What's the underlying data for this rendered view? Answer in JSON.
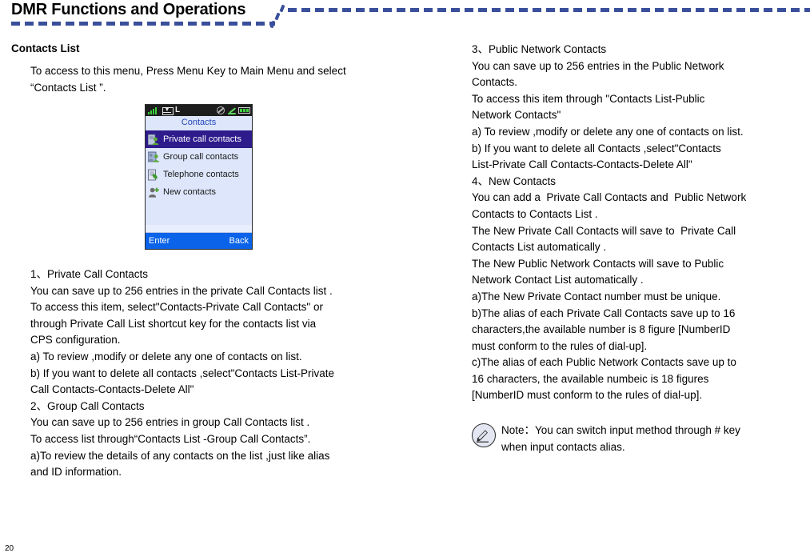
{
  "header": {
    "title": "DMR Functions and Operations",
    "rule_color": "#3a4f9b"
  },
  "left_column": {
    "heading": "Contacts List",
    "intro": "To access to this menu, Press Menu Key to Main Menu and select “Contacts List ”.",
    "phone_screenshot": {
      "status_bar": {
        "signal_icon": "signal-bars-icon",
        "message_icon": "envelope-icon",
        "mode_label": "L",
        "mute_icon": "no-entry-icon",
        "antenna_icon": "antenna-icon",
        "battery_icon": "battery-icon"
      },
      "title": "Contacts",
      "items": [
        {
          "label": "Private call contacts",
          "icon": "private-contact-icon",
          "selected": true
        },
        {
          "label": "Group call contacts",
          "icon": "group-contact-icon",
          "selected": false
        },
        {
          "label": "Telephone contacts",
          "icon": "telephone-contact-icon",
          "selected": false
        },
        {
          "label": "New contacts",
          "icon": "new-contact-icon",
          "selected": false
        }
      ],
      "softkey_left": "Enter",
      "softkey_right": "Back"
    },
    "body_lines": [
      "1、Private Call Contacts",
      "You can save up to 256 entries in the private Call Contacts list .",
      "To access this item, select\"Contacts-Private Call Contacts\" or",
      "through Private Call List shortcut key for the contacts list via",
      "CPS configuration.",
      "a) To review ,modify or delete any one of contacts on list.",
      "b) If you want to delete all contacts ,select\"Contacts List-Private",
      "Call Contacts-Contacts-Delete All\"",
      "2、Group Call Contacts",
      "You can save up to 256 entries in group Call Contacts list .",
      "To access list through“Contacts List -Group Call Contacts”.",
      "a)To review the details of any contacts on the list ,just like alias",
      "and ID information."
    ]
  },
  "right_column": {
    "body_lines": [
      "3、Public Network Contacts",
      "You can save up to 256 entries in the Public Network",
      "Contacts.",
      "To access this item through \"Contacts List-Public",
      "Network Contacts\"",
      "a) To review ,modify or delete any one of contacts on list.",
      "b) If you want to delete all Contacts ,select\"Contacts",
      "List-Private Call Contacts-Contacts-Delete All\"",
      "4、New Contacts",
      "You can add a  Private Call Contacts and  Public Network",
      "Contacts to Contacts List .",
      "The New Private Call Contacts will save to  Private Call",
      "Contacts List automatically .",
      "The New Public Network Contacts will save to Public",
      "Network Contact List automatically .",
      "a)The New Private Contact number must be unique.",
      "b)The alias of each Private Call Contacts save up to 16",
      "characters,the available number is 8 figure [NumberID",
      "must conform to the rules of dial-up].",
      "c)The alias of each Public Network Contacts save up to",
      "16 characters, the available numbeic is 18 figures",
      "[NumberID must conform to the rules of dial-up]."
    ],
    "note": {
      "icon": "pencil-note-icon",
      "lines": [
        "Note：You can switch input method through # key",
        "when input contacts alias."
      ]
    }
  },
  "footer": {
    "page_number": "20"
  }
}
